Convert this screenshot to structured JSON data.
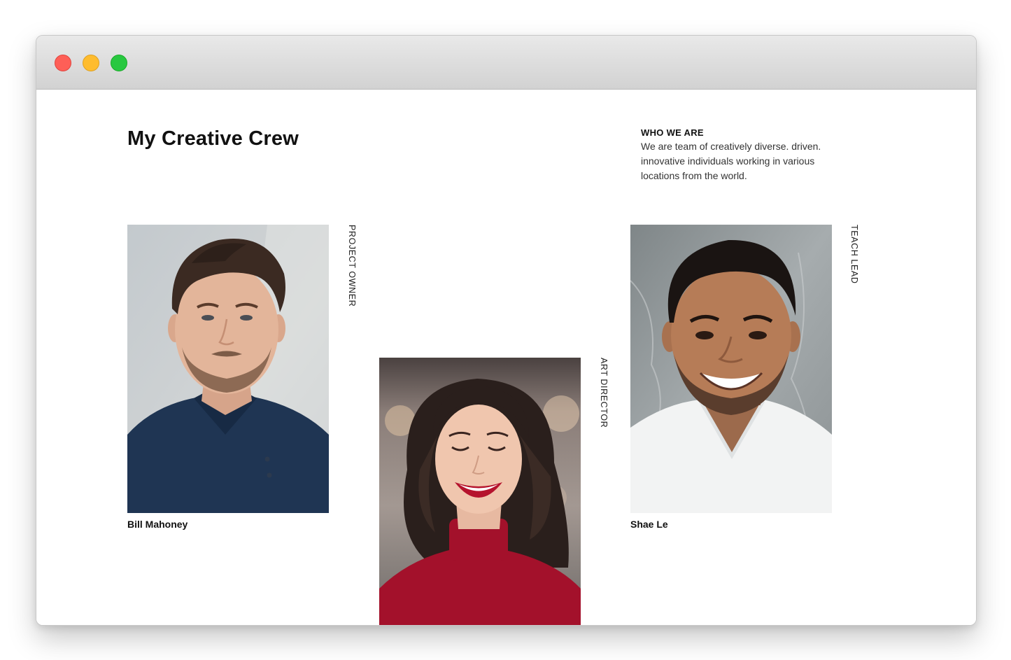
{
  "window": {
    "controls": {
      "close_icon": "close-circle-icon",
      "minimize_icon": "minimize-circle-icon",
      "maximize_icon": "maximize-circle-icon",
      "colors": {
        "close": "#fe5f57",
        "minimize": "#febc2e",
        "maximize": "#28c840"
      }
    }
  },
  "page": {
    "title": "My Creative Crew"
  },
  "about": {
    "heading": "WHO WE ARE",
    "text": "We are team of creatively diverse. driven. innovative individuals working in various locations from the world."
  },
  "team": [
    {
      "name": "Bill Mahoney",
      "role": "PROJECT OWNER",
      "photo_icon": "man-in-navy-polo-photo"
    },
    {
      "name": "",
      "role": "ART DIRECTOR",
      "photo_icon": "smiling-woman-in-red-sweater-photo"
    },
    {
      "name": "Shae Le",
      "role": "TEACH LEAD",
      "photo_icon": "smiling-man-in-white-tshirt-photo"
    }
  ]
}
